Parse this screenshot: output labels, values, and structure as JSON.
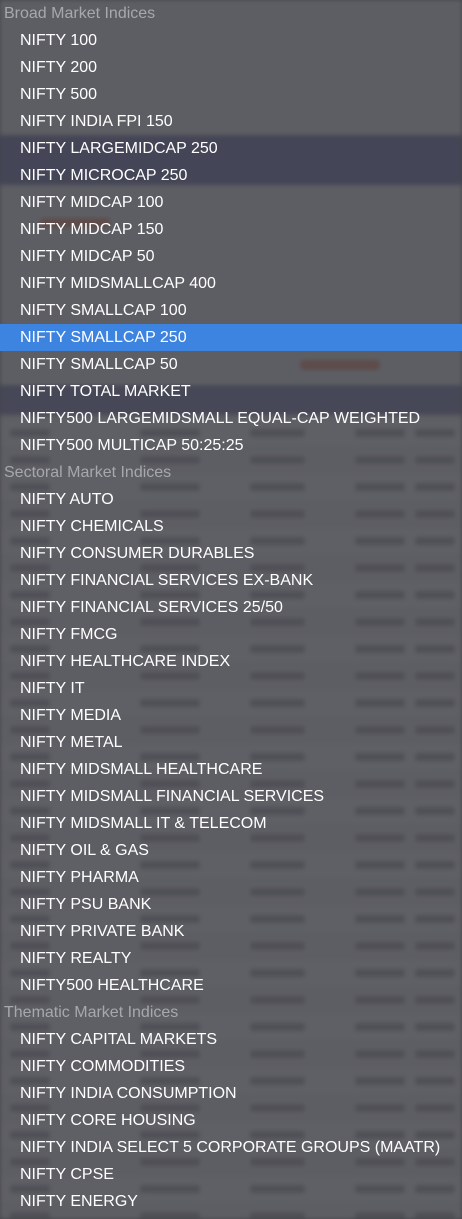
{
  "dropdown": {
    "selected": "NIFTY SMALLCAP 250",
    "groups": [
      {
        "label": "Broad Market Indices",
        "options": [
          "NIFTY 100",
          "NIFTY 200",
          "NIFTY 500",
          "NIFTY INDIA FPI 150",
          "NIFTY LARGEMIDCAP 250",
          "NIFTY MICROCAP 250",
          "NIFTY MIDCAP 100",
          "NIFTY MIDCAP 150",
          "NIFTY MIDCAP 50",
          "NIFTY MIDSMALLCAP 400",
          "NIFTY SMALLCAP 100",
          "NIFTY SMALLCAP 250",
          "NIFTY SMALLCAP 50",
          "NIFTY TOTAL MARKET",
          "NIFTY500 LARGEMIDSMALL EQUAL-CAP WEIGHTED",
          "NIFTY500 MULTICAP 50:25:25"
        ]
      },
      {
        "label": "Sectoral Market Indices",
        "options": [
          "NIFTY AUTO",
          "NIFTY CHEMICALS",
          "NIFTY CONSUMER DURABLES",
          "NIFTY FINANCIAL SERVICES EX-BANK",
          "NIFTY FINANCIAL SERVICES 25/50",
          "NIFTY FMCG",
          "NIFTY HEALTHCARE INDEX",
          "NIFTY IT",
          "NIFTY MEDIA",
          "NIFTY METAL",
          "NIFTY MIDSMALL HEALTHCARE",
          "NIFTY MIDSMALL FINANCIAL SERVICES",
          "NIFTY MIDSMALL IT & TELECOM",
          "NIFTY OIL & GAS",
          "NIFTY PHARMA",
          "NIFTY PSU BANK",
          "NIFTY PRIVATE BANK",
          "NIFTY REALTY",
          "NIFTY500 HEALTHCARE"
        ]
      },
      {
        "label": "Thematic Market Indices",
        "options": [
          "NIFTY CAPITAL MARKETS",
          "NIFTY COMMODITIES",
          "NIFTY INDIA CONSUMPTION",
          "NIFTY CORE HOUSING",
          "NIFTY INDIA SELECT 5 CORPORATE GROUPS (MAATR)",
          "NIFTY CPSE",
          "NIFTY ENERGY"
        ]
      }
    ]
  },
  "colors": {
    "highlight": "#3d83e0",
    "menu_text": "#ffffff",
    "group_text": "#a7a8ae",
    "backdrop_brand": "#3b3e8c",
    "backdrop_accent": "#e86a3a"
  }
}
